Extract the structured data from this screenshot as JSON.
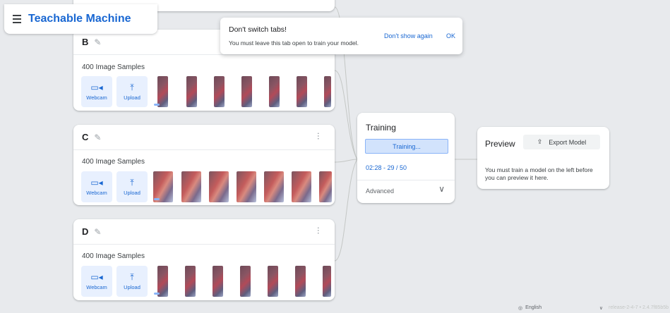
{
  "app": {
    "title": "Teachable Machine",
    "menu_icon": "hamburger-icon"
  },
  "toast": {
    "title": "Don't switch tabs!",
    "message": "You must leave this tab open to train your model.",
    "dont_show": "Don't show again",
    "ok": "OK"
  },
  "classes": [
    {
      "name": "B",
      "samples": "400 Image Samples",
      "webcam": "Webcam",
      "upload": "Upload"
    },
    {
      "name": "C",
      "samples": "400 Image Samples",
      "webcam": "Webcam",
      "upload": "Upload"
    },
    {
      "name": "D",
      "samples": "400 Image Samples",
      "webcam": "Webcam",
      "upload": "Upload"
    }
  ],
  "training": {
    "title": "Training",
    "button": "Training...",
    "progress": "02:28 - 29 / 50",
    "advanced": "Advanced"
  },
  "preview": {
    "title": "Preview",
    "export": "Export Model",
    "note": "You must train a model on the left before you can preview it here."
  },
  "footer": {
    "language": "English",
    "release": "release-2-4-7 • 2.4.7f85b5b"
  },
  "colors": {
    "accent": "#1967d2",
    "accent_light": "#e8f0fe",
    "background": "#e8eaed"
  }
}
